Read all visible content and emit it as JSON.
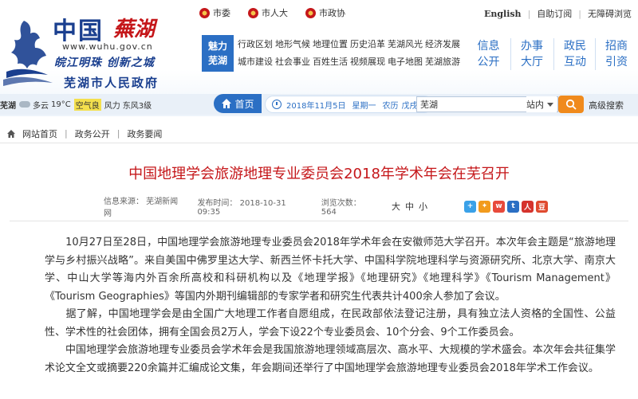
{
  "header": {
    "logo": {
      "site_name": "中国",
      "city_script": "蕪湖",
      "url": "www.wuhu.gov.cn",
      "slogan": "皖江明珠 创新之城",
      "government": "芜湖市人民政府"
    },
    "top_links": [
      {
        "label": "市委"
      },
      {
        "label": "市人大"
      },
      {
        "label": "市政协"
      }
    ],
    "util_links": [
      "English",
      "自助订阅",
      "无障碍浏览"
    ],
    "nav_feature": [
      "魅力",
      "芜湖"
    ],
    "nav_grid": [
      "行政区划",
      "地形气候",
      "地理位置",
      "历史沿革",
      "芜湖风光",
      "经济发展",
      "城市建设",
      "社会事业",
      "百姓生活",
      "视频展现",
      "电子地图",
      "芜湖旅游"
    ],
    "nav_big": [
      {
        "top": "信息",
        "bottom": "公开"
      },
      {
        "top": "办事",
        "bottom": "大厅"
      },
      {
        "top": "政民",
        "bottom": "互动"
      },
      {
        "top": "招商",
        "bottom": "引资"
      }
    ],
    "weather": {
      "city": "芜湖",
      "condition": "多云",
      "temp": "19°C",
      "aqi": "空气良",
      "wind": "风力",
      "wind_level": "东风3级"
    },
    "home_label": "首页",
    "date": {
      "date": "2018年11月5日",
      "weekday": "星期一",
      "lunar_label": "农历",
      "lunar": "戊戌年"
    },
    "search": {
      "value": "芜湖",
      "scope": "站内"
    },
    "adv_search": "高级搜索"
  },
  "breadcrumb": [
    "网站首页",
    "政务公开",
    "政务要闻"
  ],
  "article": {
    "title": "中国地理学会旅游地理专业委员会2018年学术年会在芜召开",
    "source": "信息来源：  芜湖新闻网",
    "published": "发布时间：  2018-10-31 09:35",
    "views": "浏览次数：  564",
    "font_sizes": [
      "大",
      "中",
      "小"
    ],
    "share_colors": [
      "#3aa1e8",
      "#f29b1d",
      "#e84a3b",
      "#2b6fc4",
      "#d5332d",
      "#e04a2f"
    ],
    "paragraphs": [
      "　　10月27日至28日，中国地理学会旅游地理专业委员会2018年学术年会在安徽师范大学召开。本次年会主题是“旅游地理学与乡村振兴战略”。来自美国中佛罗里达大学、新西兰怀卡托大学、中国科学院地理科学与资源研究所、北京大学、南京大学、中山大学等海内外百余所高校和科研机构以及《地理学报》《地理研究》《地理科学》《Tourism Management》《Tourism Geographies》等国内外期刊编辑部的专家学者和研究生代表共计400余人参加了会议。",
      "　　据了解，中国地理学会是由全国广大地理工作者自愿组成，在民政部依法登记注册，具有独立法人资格的全国性、公益性、学术性的社会团体，拥有全国会员2万人，学会下设22个专业委员会、10个分会、9个工作委员会。",
      "　　中国地理学会旅游地理专业委员会学术年会是我国旅游地理领域高层次、高水平、大规模的学术盛会。本次年会共征集学术论文全文或摘要220余篇并汇编成论文集，年会期间还举行了中国地理学会旅游地理专业委员会2018年学术工作会议。"
    ]
  },
  "colors": {
    "brand_blue": "#2b6fc4",
    "title_red": "#c5171a",
    "search_orange": "#f08a1c"
  }
}
